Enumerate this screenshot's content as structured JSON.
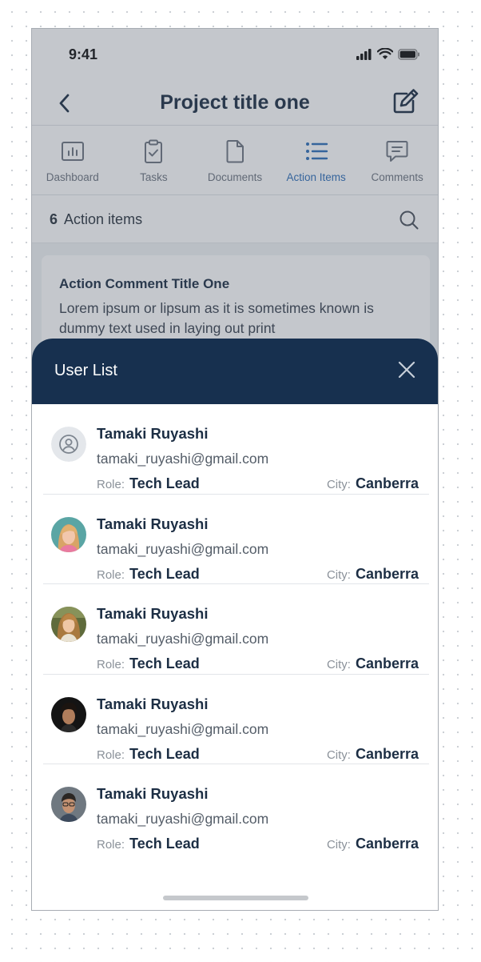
{
  "statusbar": {
    "time": "9:41"
  },
  "navbar": {
    "title": "Project title one"
  },
  "tabs": [
    {
      "label": "Dashboard",
      "icon": "dashboard-icon",
      "active": false
    },
    {
      "label": "Tasks",
      "icon": "clipboard-check-icon",
      "active": false
    },
    {
      "label": "Documents",
      "icon": "document-icon",
      "active": false
    },
    {
      "label": "Action Items",
      "icon": "list-icon",
      "active": true
    },
    {
      "label": "Comments",
      "icon": "comment-icon",
      "active": false
    }
  ],
  "countbar": {
    "count": "6",
    "label": "Action items"
  },
  "card": {
    "title": "Action Comment Title One",
    "text": "Lorem ipsum or lipsum as it is sometimes known is dummy text used in laying out print"
  },
  "sheet": {
    "title": "User List",
    "role_label": "Role:",
    "city_label": "City:",
    "users": [
      {
        "name": "Tamaki Ruyashi",
        "email": "tamaki_ruyashi@gmail.com",
        "role": "Tech Lead",
        "city": "Canberra",
        "avatar": "default-avatar-icon"
      },
      {
        "name": "Tamaki Ruyashi",
        "email": "tamaki_ruyashi@gmail.com",
        "role": "Tech Lead",
        "city": "Canberra",
        "avatar": "user-photo"
      },
      {
        "name": "Tamaki Ruyashi",
        "email": "tamaki_ruyashi@gmail.com",
        "role": "Tech Lead",
        "city": "Canberra",
        "avatar": "user-photo"
      },
      {
        "name": "Tamaki Ruyashi",
        "email": "tamaki_ruyashi@gmail.com",
        "role": "Tech Lead",
        "city": "Canberra",
        "avatar": "user-photo"
      },
      {
        "name": "Tamaki Ruyashi",
        "email": "tamaki_ruyashi@gmail.com",
        "role": "Tech Lead",
        "city": "Canberra",
        "avatar": "user-photo"
      }
    ]
  },
  "colors": {
    "primary_dark": "#17304f",
    "accent_blue": "#2f6fb9",
    "text_dark": "#1c2e44"
  }
}
